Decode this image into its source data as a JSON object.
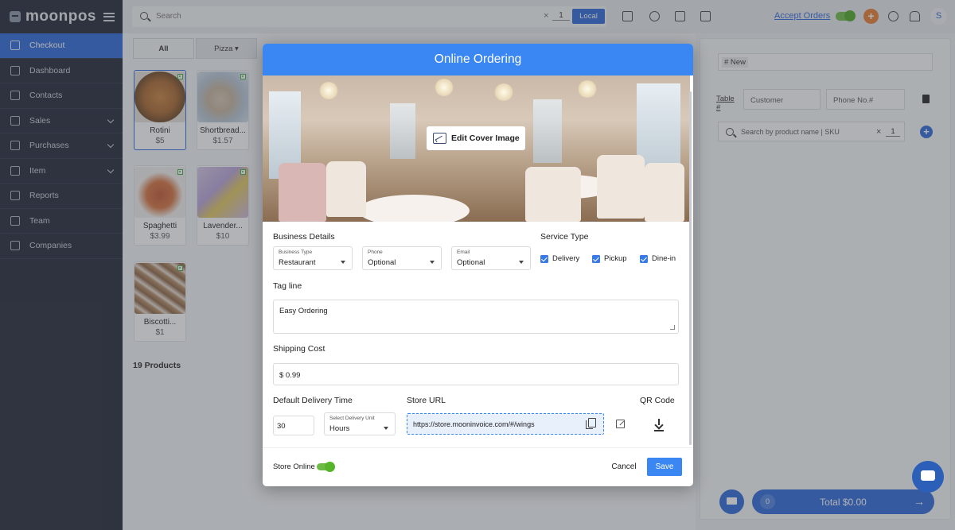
{
  "brand": {
    "name": "moonpos"
  },
  "sidebar": {
    "items": [
      {
        "label": "Checkout",
        "active": true,
        "expandable": false
      },
      {
        "label": "Dashboard",
        "active": false,
        "expandable": false
      },
      {
        "label": "Contacts",
        "active": false,
        "expandable": false
      },
      {
        "label": "Sales",
        "active": false,
        "expandable": true
      },
      {
        "label": "Purchases",
        "active": false,
        "expandable": true
      },
      {
        "label": "Item",
        "active": false,
        "expandable": true
      },
      {
        "label": "Reports",
        "active": false,
        "expandable": false
      },
      {
        "label": "Team",
        "active": false,
        "expandable": false
      },
      {
        "label": "Companies",
        "active": false,
        "expandable": false
      }
    ]
  },
  "topbar": {
    "search_placeholder": "Search",
    "clear_symbol": "×",
    "quantity": "1",
    "local_label": "Local",
    "accept_orders_label": "Accept Orders",
    "add_symbol": "+",
    "avatar_initial": "S"
  },
  "products": {
    "tabs": [
      {
        "label": "All"
      },
      {
        "label": "Pizza ▾"
      }
    ],
    "items": [
      {
        "name": "Rotini",
        "price": "$5"
      },
      {
        "name": "Shortbread...",
        "price": "$1.57"
      },
      {
        "name": "Spaghetti",
        "price": "$3.99"
      },
      {
        "name": "Lavender...",
        "price": "$10"
      },
      {
        "name": "Biscotti...",
        "price": "$1"
      }
    ],
    "count_label": "19 Products"
  },
  "cart": {
    "order_label": "# New",
    "table_label": "Table #",
    "customer_placeholder": "Customer",
    "phone_placeholder": "Phone No.#",
    "search_placeholder": "Search by product name | SKU",
    "clear_symbol": "×",
    "quantity": "1",
    "add_symbol": "+",
    "item_count": "0",
    "total_label": "Total $0.00",
    "arrow": "→"
  },
  "modal": {
    "title": "Online Ordering",
    "edit_cover_label": "Edit Cover Image",
    "business_details_title": "Business Details",
    "business_type": {
      "label": "Business Type",
      "value": "Restaurant"
    },
    "phone": {
      "label": "Phone",
      "value": "Optional"
    },
    "email": {
      "label": "Email",
      "value": "Optional"
    },
    "service_type_title": "Service Type",
    "service_types": [
      {
        "label": "Delivery",
        "checked": true
      },
      {
        "label": "Pickup",
        "checked": true
      },
      {
        "label": "Dine-in",
        "checked": true
      }
    ],
    "tag_line_title": "Tag line",
    "tag_line_value": "Easy Ordering",
    "shipping_cost_title": "Shipping Cost",
    "shipping_cost_value": "$ 0.99",
    "delivery_time_title": "Default Delivery Time",
    "delivery_time_value": "30",
    "delivery_unit": {
      "label": "Select Delivery Unit",
      "value": "Hours"
    },
    "store_url_title": "Store URL",
    "store_url_value": "https://store.mooninvoice.com/#/wings",
    "qr_code_title": "QR Code",
    "store_online_label": "Store Online",
    "cancel_label": "Cancel",
    "save_label": "Save"
  },
  "colors": {
    "accent": "#2b66d9",
    "modal_header": "#3a86f2",
    "toggle_on": "#6dbb45",
    "orange": "#ea7a2d",
    "sidebar": "#1e2433"
  }
}
